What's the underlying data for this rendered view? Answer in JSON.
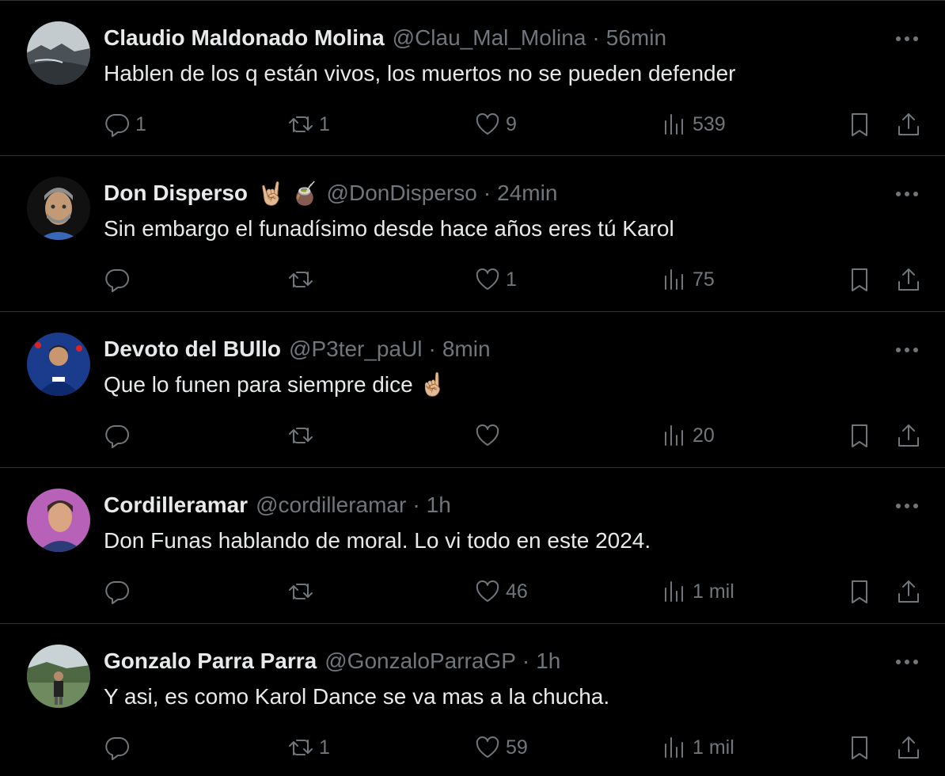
{
  "tweets": [
    {
      "name": "Claudio Maldonado Molina",
      "emoji": "",
      "handle": "@Clau_Mal_Molina",
      "time": "56min",
      "text": "Hablen de los q están vivos, los muertos no se pueden defender",
      "replies": "1",
      "retweets": "1",
      "likes": "9",
      "views": "539"
    },
    {
      "name": "Don Disperso",
      "emoji": "🤘🏼 🧉",
      "handle": "@DonDisperso",
      "time": "24min",
      "text": "Sin embargo el funadísimo desde hace años eres tú Karol",
      "replies": "",
      "retweets": "",
      "likes": "1",
      "views": "75"
    },
    {
      "name": "Devoto del BUllo",
      "emoji": "",
      "handle": "@P3ter_paUl",
      "time": "8min",
      "text": "Que lo funen para siempre dice ☝🏼",
      "replies": "",
      "retweets": "",
      "likes": "",
      "views": "20"
    },
    {
      "name": "Cordilleramar",
      "emoji": "",
      "handle": "@cordilleramar",
      "time": "1h",
      "text": "Don Funas hablando de moral. Lo vi todo en este 2024.",
      "replies": "",
      "retweets": "",
      "likes": "46",
      "views": "1 mil"
    },
    {
      "name": "Gonzalo Parra Parra",
      "emoji": "",
      "handle": "@GonzaloParraGP",
      "time": "1h",
      "text": "Y asi, es como Karol Dance se va mas a la chucha.",
      "replies": "",
      "retweets": "1",
      "likes": "59",
      "views": "1 mil"
    }
  ],
  "separator": "·",
  "colors": {
    "background": "#000000",
    "text": "#e7e9ea",
    "secondary": "#71767b",
    "divider": "#2f3336"
  },
  "icons": [
    "reply-icon",
    "retweet-icon",
    "like-icon",
    "views-icon",
    "bookmark-icon",
    "share-icon",
    "more-icon"
  ]
}
